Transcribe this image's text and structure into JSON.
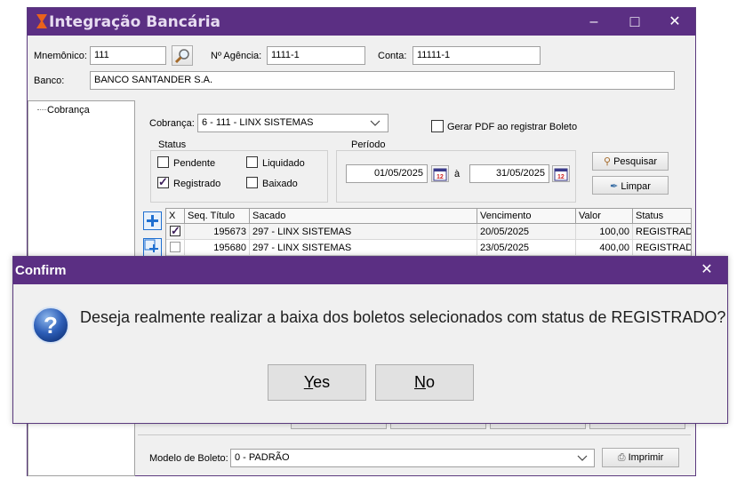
{
  "window": {
    "title": "Integração Bancária",
    "minimize_glyph": "–",
    "maximize_glyph": "□",
    "close_glyph": "✕"
  },
  "header": {
    "mnemonico_label": "Mnemônico:",
    "mnemonico_value": "111",
    "agencia_label": "Nº Agência:",
    "agencia_value": "1111-1",
    "conta_label": "Conta:",
    "conta_value": "11111-1",
    "banco_label": "Banco:",
    "banco_value": "BANCO SANTANDER S.A."
  },
  "tree": {
    "items": [
      "Cobrança"
    ]
  },
  "filters": {
    "cobranca_label": "Cobrança:",
    "cobranca_value": "6 - 111 - LINX SISTEMAS",
    "gerar_pdf_label": "Gerar PDF ao registrar Boleto",
    "gerar_pdf_checked": false,
    "status_group_label": "Status",
    "status": [
      {
        "label": "Pendente",
        "checked": false
      },
      {
        "label": "Liquidado",
        "checked": false
      },
      {
        "label": "Registrado",
        "checked": true
      },
      {
        "label": "Baixado",
        "checked": false
      }
    ],
    "periodo_group_label": "Período",
    "date_from": "01/05/2025",
    "date_sep": "à",
    "date_to": "31/05/2025",
    "pesquisar_label": "Pesquisar",
    "limpar_label": "Limpar"
  },
  "grid": {
    "columns": [
      "X",
      "Seq. Título",
      "Sacado",
      "Vencimento",
      "Valor",
      "Status"
    ],
    "rows": [
      {
        "checked": true,
        "seq": "195673",
        "sacado": "297 - LINX SISTEMAS",
        "vencimento": "20/05/2025",
        "valor": "100,00",
        "status": "REGISTRADO"
      },
      {
        "checked": false,
        "seq": "195680",
        "sacado": "297 - LINX SISTEMAS",
        "vencimento": "23/05/2025",
        "valor": "400,00",
        "status": "REGISTRADO"
      }
    ]
  },
  "footer": {
    "modelo_label": "Modelo de Boleto:",
    "modelo_value": "0 - PADRÃO",
    "imprimir_label": "Imprimir"
  },
  "dialog": {
    "title": "Confirm",
    "close_glyph": "✕",
    "message": "Deseja realmente realizar a baixa dos boletos selecionados com status de REGISTRADO?",
    "icon_glyph": "?",
    "yes_accel": "Y",
    "yes_rest": "es",
    "no_accel": "N",
    "no_rest": "o"
  },
  "colors": {
    "titlebar": "#5b2f83",
    "title_text": "#e7dcf1",
    "accent_icon": "#1f6fd0"
  }
}
